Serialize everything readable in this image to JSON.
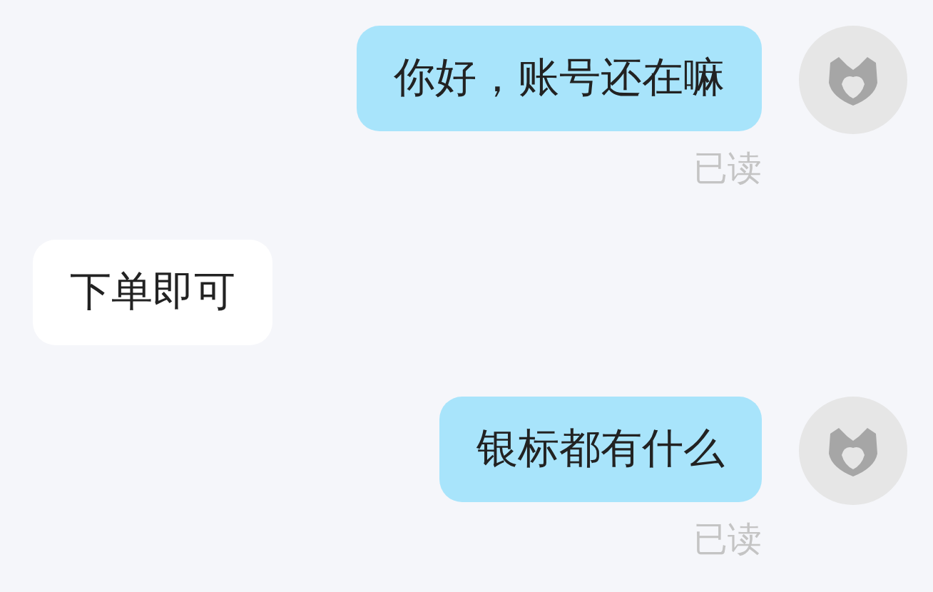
{
  "messages": [
    {
      "kind": "sent",
      "text": "你好，账号还在嘛",
      "status": "已读"
    },
    {
      "kind": "received",
      "text": "下单即可"
    },
    {
      "kind": "sent",
      "text": "银标都有什么",
      "status": "已读"
    }
  ]
}
